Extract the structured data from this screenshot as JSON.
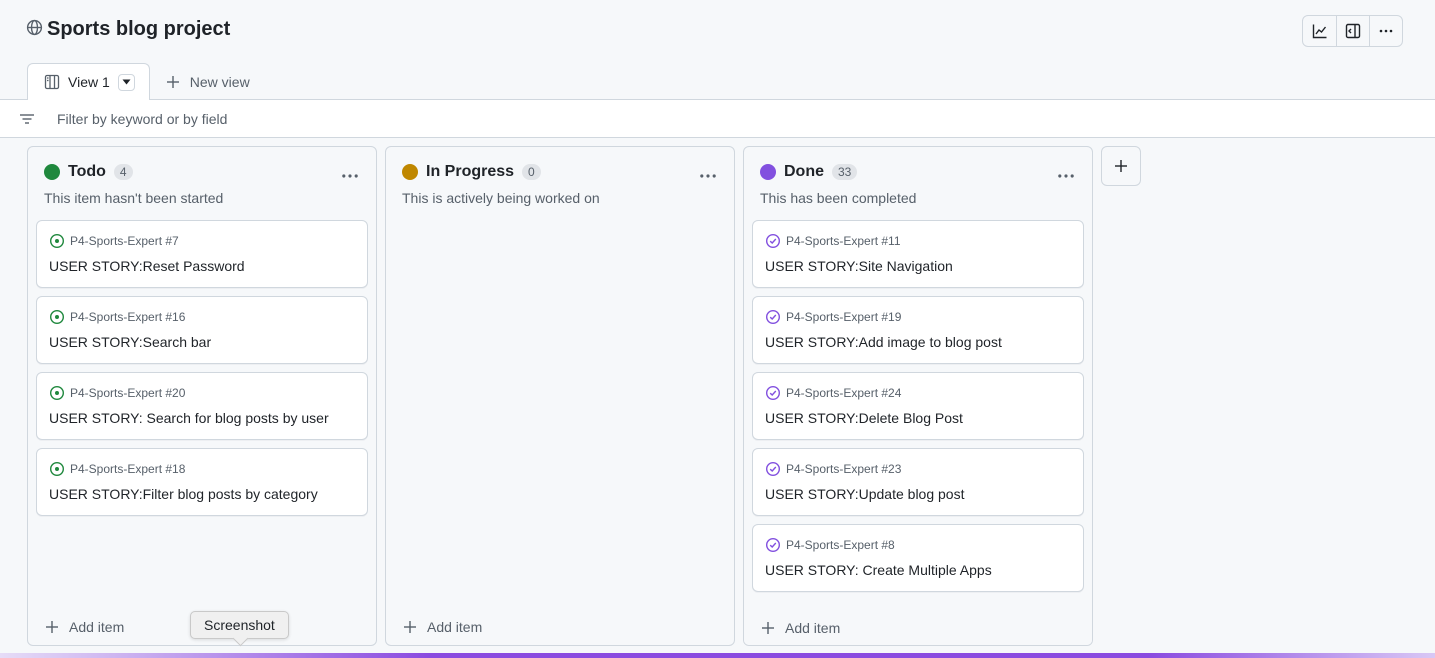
{
  "project": {
    "title": "Sports blog project",
    "icon": "globe-icon"
  },
  "toolbar": {
    "insights_icon": "graph-icon",
    "side_panel_icon": "layout-sidebar-icon",
    "more_icon": "kebab-icon"
  },
  "tabs": {
    "active_label": "View 1",
    "new_view_label": "New view"
  },
  "filter": {
    "placeholder": "Filter by keyword or by field"
  },
  "colors": {
    "todo": "#1f883d",
    "in_progress": "#bf8700",
    "done": "#8250df"
  },
  "columns": [
    {
      "title": "Todo",
      "count": "4",
      "description": "This item hasn't been started",
      "add_label": "Add item",
      "cards": [
        {
          "repo": "P4-Sports-Expert #7",
          "title": "USER STORY:Reset Password"
        },
        {
          "repo": "P4-Sports-Expert #16",
          "title": "USER STORY:Search bar"
        },
        {
          "repo": "P4-Sports-Expert #20",
          "title": "USER STORY: Search for blog posts by user"
        },
        {
          "repo": "P4-Sports-Expert #18",
          "title": "USER STORY:Filter blog posts by category"
        }
      ]
    },
    {
      "title": "In Progress",
      "count": "0",
      "description": "This is actively being worked on",
      "add_label": "Add item",
      "cards": []
    },
    {
      "title": "Done",
      "count": "33",
      "description": "This has been completed",
      "add_label": "Add item",
      "cards": [
        {
          "repo": "P4-Sports-Expert #11",
          "title": "USER STORY:Site Navigation"
        },
        {
          "repo": "P4-Sports-Expert #19",
          "title": "USER STORY:Add image to blog post"
        },
        {
          "repo": "P4-Sports-Expert #24",
          "title": "USER STORY:Delete Blog Post"
        },
        {
          "repo": "P4-Sports-Expert #23",
          "title": "USER STORY:Update blog post"
        },
        {
          "repo": "P4-Sports-Expert #8",
          "title": "USER STORY: Create Multiple Apps"
        }
      ]
    }
  ],
  "tooltip": {
    "text": "Screenshot"
  }
}
